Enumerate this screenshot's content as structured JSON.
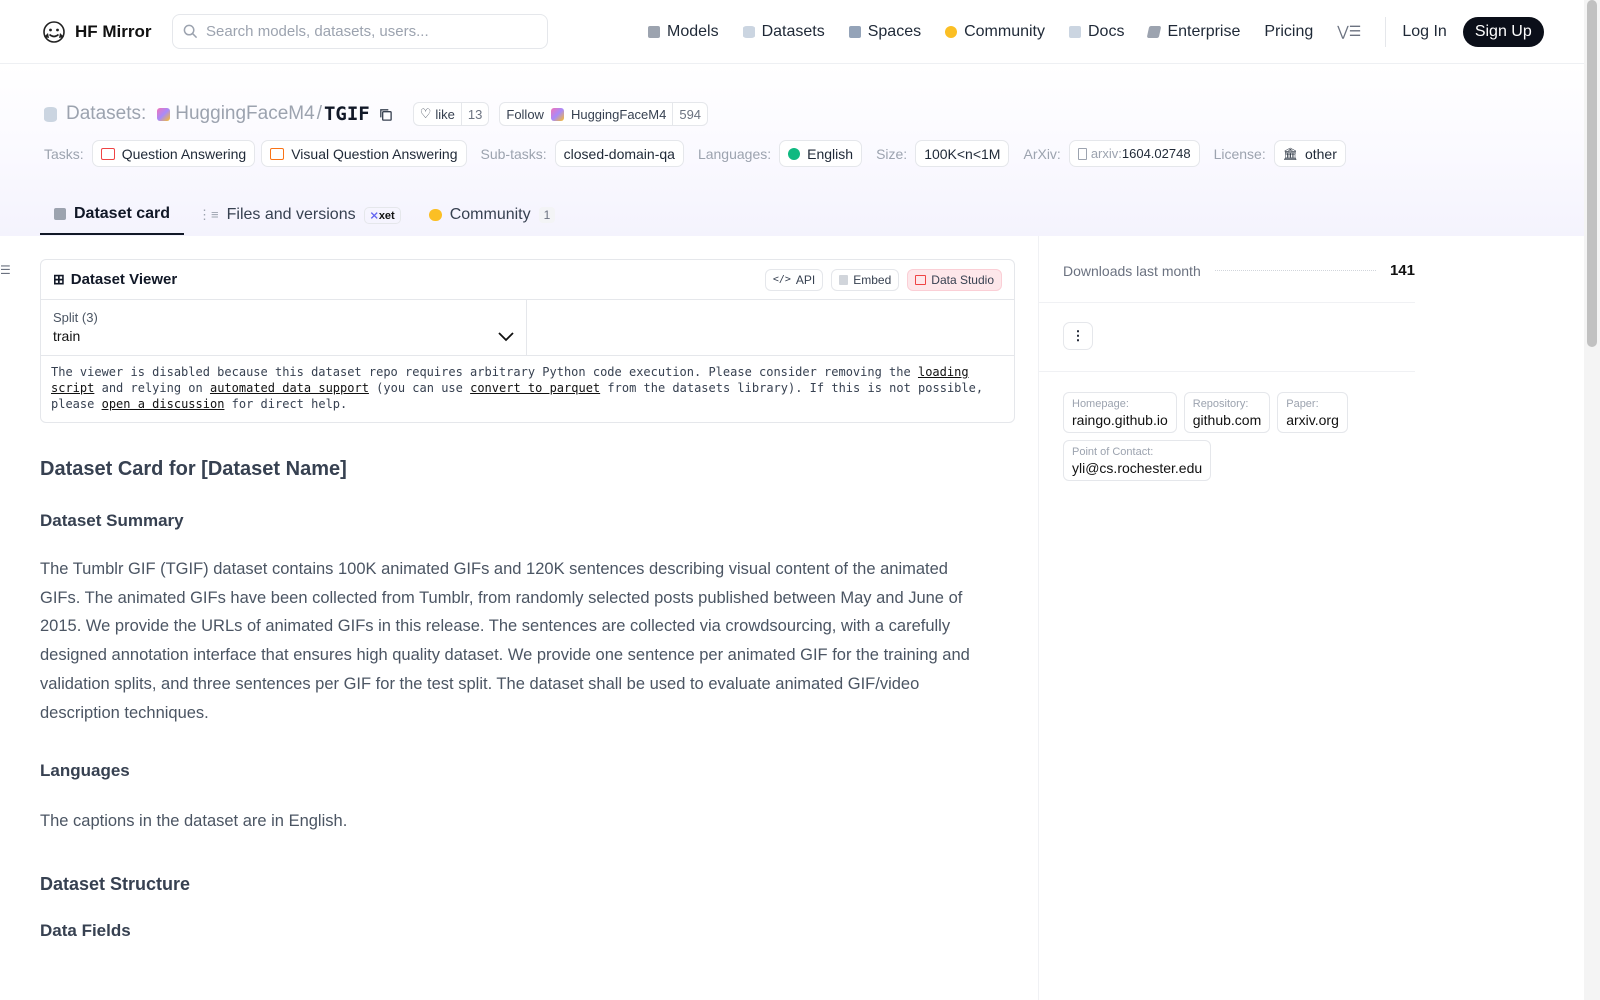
{
  "brand": {
    "name": "HF Mirror"
  },
  "search": {
    "placeholder": "Search models, datasets, users..."
  },
  "nav": {
    "items": [
      {
        "label": "Models",
        "icon": "cube-icon",
        "color": "#9ca3af"
      },
      {
        "label": "Datasets",
        "icon": "database-icon",
        "color": "#cbd5e1"
      },
      {
        "label": "Spaces",
        "icon": "grid-icon",
        "color": "#94a3b8"
      },
      {
        "label": "Community",
        "icon": "chat-icon",
        "color": "#fbbf24"
      },
      {
        "label": "Docs",
        "icon": "book-icon",
        "color": "#cbd5e1"
      },
      {
        "label": "Enterprise",
        "icon": "briefcase-icon",
        "color": "#9ca3af"
      },
      {
        "label": "Pricing"
      }
    ],
    "login": "Log In",
    "signup": "Sign Up"
  },
  "header": {
    "type_label": "Datasets:",
    "org": "HuggingFaceM4",
    "slash": "/",
    "name": "TGIF",
    "like_label": "like",
    "like_count": "13",
    "follow_label": "Follow",
    "follow_org": "HuggingFaceM4",
    "follow_count": "594"
  },
  "tags": {
    "tasks_label": "Tasks:",
    "tasks": [
      "Question Answering",
      "Visual Question Answering"
    ],
    "subtasks_label": "Sub-tasks:",
    "subtask": "closed-domain-qa",
    "languages_label": "Languages:",
    "language": "English",
    "size_label": "Size:",
    "size": "100K<n<1M",
    "arxiv_label": "ArXiv:",
    "arxiv_prefix": "arxiv:",
    "arxiv_id": "1604.02748",
    "license_label": "License:",
    "license": "other"
  },
  "tabs": {
    "card": "Dataset card",
    "files": "Files and versions",
    "xet": "xet",
    "community": "Community",
    "community_count": "1"
  },
  "viewer": {
    "title": "Dataset Viewer",
    "api": "API",
    "embed": "Embed",
    "studio": "Data Studio",
    "split_label": "Split (3)",
    "split_value": "train",
    "msg_1": "The viewer is disabled because this dataset repo requires arbitrary Python code execution. Please consider removing the",
    "link_loading": "loading script",
    "msg_2": "and relying on",
    "link_auto": "automated data support",
    "msg_3": "(you can use",
    "link_parquet": "convert to parquet",
    "msg_4": "from the datasets library). If this is not possible, please",
    "link_discussion": "open a discussion",
    "msg_5": "for direct help."
  },
  "card": {
    "title": "Dataset Card for [Dataset Name]",
    "summary_heading": "Dataset Summary",
    "summary_text": "The Tumblr GIF (TGIF) dataset contains 100K animated GIFs and 120K sentences describing visual content of the animated GIFs. The animated GIFs have been collected from Tumblr, from randomly selected posts published between May and June of 2015. We provide the URLs of animated GIFs in this release. The sentences are collected via crowdsourcing, with a carefully designed annotation interface that ensures high quality dataset. We provide one sentence per animated GIF for the training and validation splits, and three sentences per GIF for the test split. The dataset shall be used to evaluate animated GIF/video description techniques.",
    "languages_heading": "Languages",
    "languages_text": "The captions in the dataset are in English.",
    "structure_heading": "Dataset Structure",
    "fields_heading": "Data Fields"
  },
  "sidebar": {
    "downloads_label": "Downloads last month",
    "downloads_value": "141",
    "links": [
      {
        "key": "Homepage:",
        "value": "raingo.github.io"
      },
      {
        "key": "Repository:",
        "value": "github.com"
      },
      {
        "key": "Paper:",
        "value": "arxiv.org"
      },
      {
        "key": "Point of Contact:",
        "value": "yli@cs.rochester.edu"
      }
    ]
  }
}
